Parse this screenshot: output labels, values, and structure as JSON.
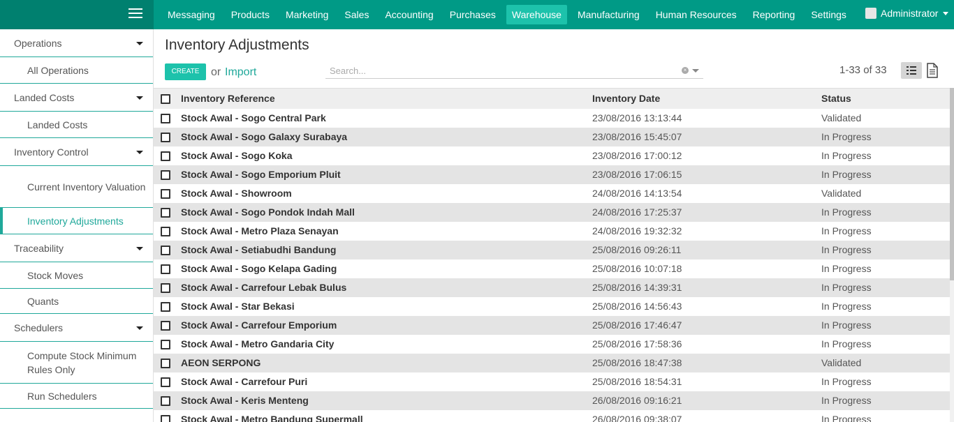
{
  "navbar": {
    "menu": [
      {
        "label": "Messaging",
        "active": false
      },
      {
        "label": "Products",
        "active": false
      },
      {
        "label": "Marketing",
        "active": false
      },
      {
        "label": "Sales",
        "active": false
      },
      {
        "label": "Accounting",
        "active": false
      },
      {
        "label": "Purchases",
        "active": false
      },
      {
        "label": "Warehouse",
        "active": true
      },
      {
        "label": "Manufacturing",
        "active": false
      },
      {
        "label": "Human Resources",
        "active": false
      },
      {
        "label": "Reporting",
        "active": false
      },
      {
        "label": "Settings",
        "active": false
      }
    ],
    "user": "Administrator",
    "colors": {
      "bar": "#009a86",
      "active": "#1dc2ab"
    }
  },
  "sidebar": {
    "sections": [
      {
        "label": "Operations",
        "items": [
          "All Operations"
        ]
      },
      {
        "label": "Landed Costs",
        "items": [
          "Landed Costs"
        ]
      },
      {
        "label": "Inventory Control",
        "items": [
          "Current Inventory Valuation",
          "Inventory Adjustments"
        ]
      },
      {
        "label": "Traceability",
        "items": [
          "Stock Moves",
          "Quants"
        ]
      },
      {
        "label": "Schedulers",
        "items": [
          "Compute Stock Minimum Rules Only",
          "Run Schedulers"
        ]
      }
    ],
    "active_item": "Inventory Adjustments"
  },
  "main": {
    "title": "Inventory Adjustments",
    "create_label": "CREATE",
    "or_label": "or",
    "import_label": "Import",
    "search_placeholder": "Search...",
    "pager": "1-33 of 33"
  },
  "table": {
    "columns": [
      "Inventory Reference",
      "Inventory Date",
      "Status"
    ],
    "rows": [
      {
        "ref": "Stock Awal - Sogo Central Park",
        "date": "23/08/2016 13:13:44",
        "status": "Validated"
      },
      {
        "ref": "Stock Awal - Sogo Galaxy Surabaya",
        "date": "23/08/2016 15:45:07",
        "status": "In Progress"
      },
      {
        "ref": "Stock Awal - Sogo Koka",
        "date": "23/08/2016 17:00:12",
        "status": "In Progress"
      },
      {
        "ref": "Stock Awal - Sogo Emporium Pluit",
        "date": "23/08/2016 17:06:15",
        "status": "In Progress"
      },
      {
        "ref": "Stock Awal - Showroom",
        "date": "24/08/2016 14:13:54",
        "status": "Validated"
      },
      {
        "ref": "Stock Awal - Sogo Pondok Indah Mall",
        "date": "24/08/2016 17:25:37",
        "status": "In Progress"
      },
      {
        "ref": "Stock Awal - Metro Plaza Senayan",
        "date": "24/08/2016 19:32:32",
        "status": "In Progress"
      },
      {
        "ref": "Stock Awal - Setiabudhi Bandung",
        "date": "25/08/2016 09:26:11",
        "status": "In Progress"
      },
      {
        "ref": "Stock Awal - Sogo Kelapa Gading",
        "date": "25/08/2016 10:07:18",
        "status": "In Progress"
      },
      {
        "ref": "Stock Awal - Carrefour Lebak Bulus",
        "date": "25/08/2016 14:39:31",
        "status": "In Progress"
      },
      {
        "ref": "Stock Awal - Star Bekasi",
        "date": "25/08/2016 14:56:43",
        "status": "In Progress"
      },
      {
        "ref": "Stock Awal - Carrefour Emporium",
        "date": "25/08/2016 17:46:47",
        "status": "In Progress"
      },
      {
        "ref": "Stock Awal - Metro Gandaria City",
        "date": "25/08/2016 17:58:36",
        "status": "In Progress"
      },
      {
        "ref": "AEON SERPONG",
        "date": "25/08/2016 18:47:38",
        "status": "Validated"
      },
      {
        "ref": "Stock Awal - Carrefour Puri",
        "date": "25/08/2016 18:54:31",
        "status": "In Progress"
      },
      {
        "ref": "Stock Awal - Keris Menteng",
        "date": "26/08/2016 09:16:21",
        "status": "In Progress"
      },
      {
        "ref": "Stock Awal - Metro Bandung Supermall",
        "date": "26/08/2016 09:38:07",
        "status": "In Progress"
      }
    ]
  }
}
